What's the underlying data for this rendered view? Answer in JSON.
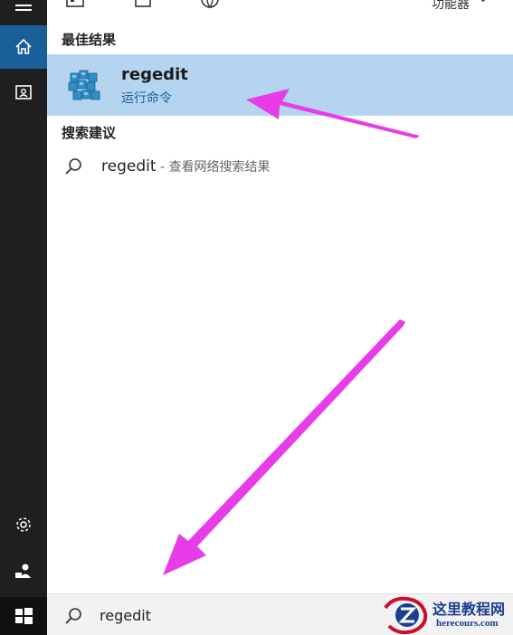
{
  "top_toolbar": {
    "location_label": "功能器",
    "icons": [
      "calendar-icon",
      "document-icon",
      "globe-icon",
      "chevron-down-icon"
    ]
  },
  "sidebar": {
    "items": [
      {
        "name": "hamburger-menu-icon"
      },
      {
        "name": "home-icon",
        "selected": true
      },
      {
        "name": "notebook-icon"
      },
      {
        "name": "settings-gear-icon"
      },
      {
        "name": "feedback-people-icon"
      },
      {
        "name": "windows-start-icon"
      }
    ]
  },
  "results": {
    "best_match_header": "最佳结果",
    "best_match": {
      "title": "regedit",
      "subtitle": "运行命令",
      "icon": "registry-editor-icon"
    },
    "suggestions_header": "搜索建议",
    "suggestions": [
      {
        "term": "regedit",
        "hint": " - 查看网络搜索结果",
        "icon": "search-icon"
      }
    ]
  },
  "search": {
    "value": "regedit",
    "icon": "search-icon"
  },
  "watermark": {
    "title": "这里教程网",
    "url": "herecours.com"
  },
  "colors": {
    "selected_row": "#b5d4ef",
    "accent_blue": "#1b5f9a",
    "annotation_arrow": "#e73ce7",
    "rail": "#1f1f1f"
  }
}
